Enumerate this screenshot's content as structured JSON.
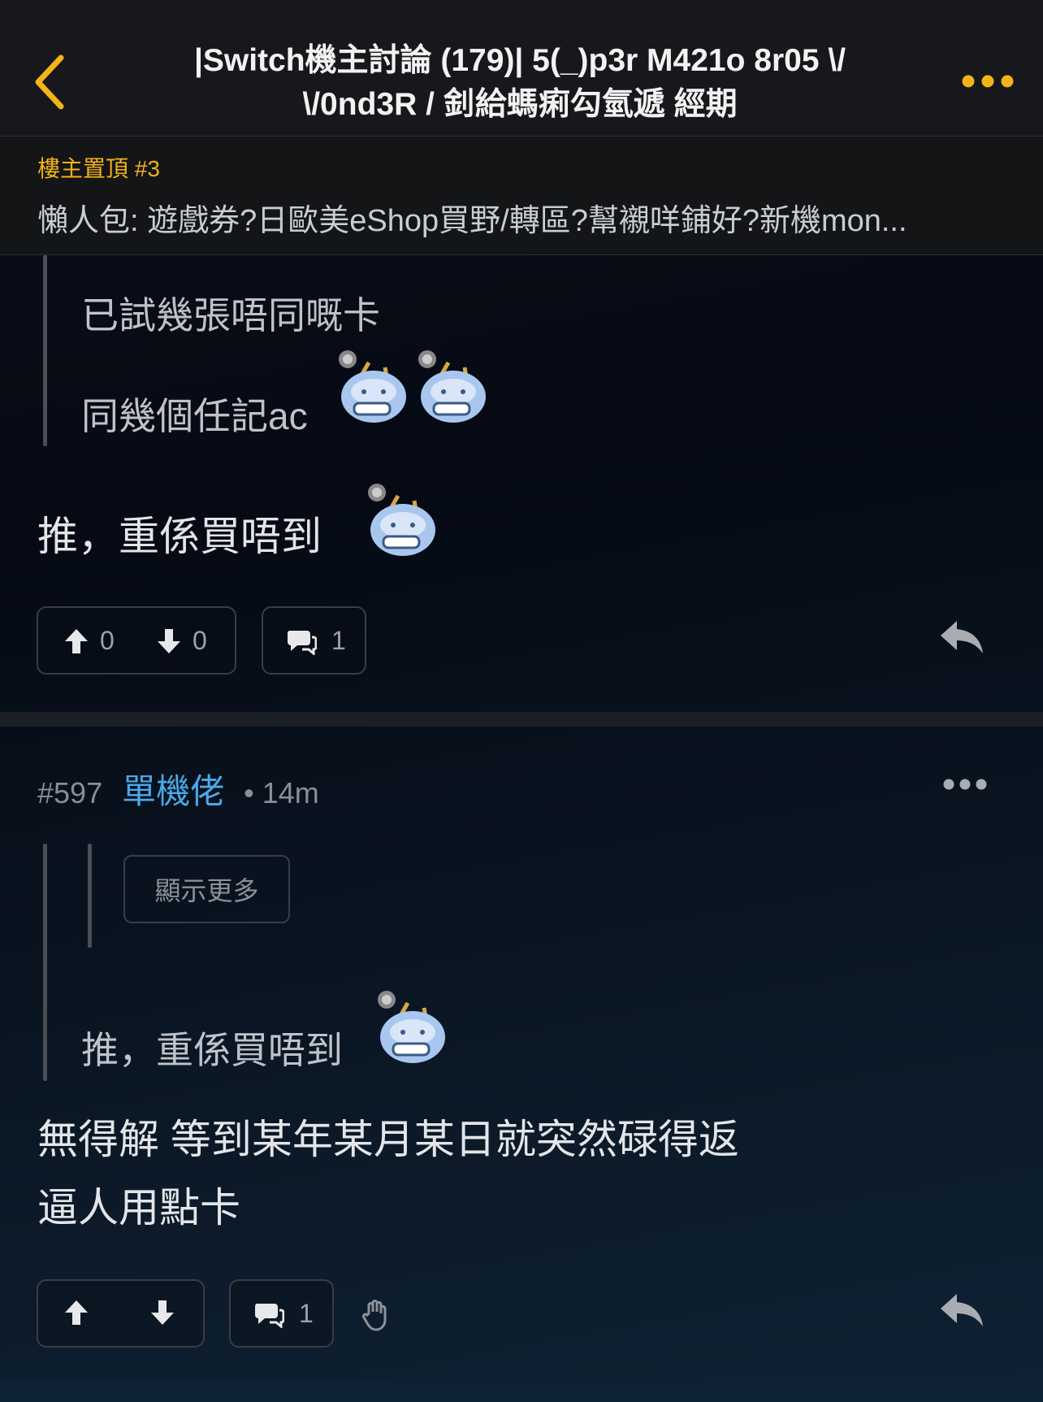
{
  "header": {
    "title_line1": "|Switch機主討論 (179)| 5(_)p3r M421o 8r05 \\/",
    "title_line2": "\\/0nd3R / 釗給螞痢勾氫遞 經期"
  },
  "pinned": {
    "label": "樓主置頂 #3",
    "text": "懶人包: 遊戲券?日歐美eShop買野/轉區?幫襯咩鋪好?新機mon..."
  },
  "post_596": {
    "quote_line1": "已試幾張唔同嘅卡",
    "quote_line2": "同幾個任記ac",
    "body": "推，重係買唔到",
    "upvotes": "0",
    "downvotes": "0",
    "replies": "1"
  },
  "post_597": {
    "number": "#597",
    "user": "單機佬",
    "time": "• 14m",
    "show_more": "顯示更多",
    "quote": "推，重係買唔到",
    "body_line1": "無得解 等到某年某月某日就突然碌得返",
    "body_line2": "逼人用點卡",
    "replies": "1"
  },
  "colors": {
    "accent": "#f4b318",
    "username": "#4aa9e8",
    "header_bg": "#17181b"
  }
}
